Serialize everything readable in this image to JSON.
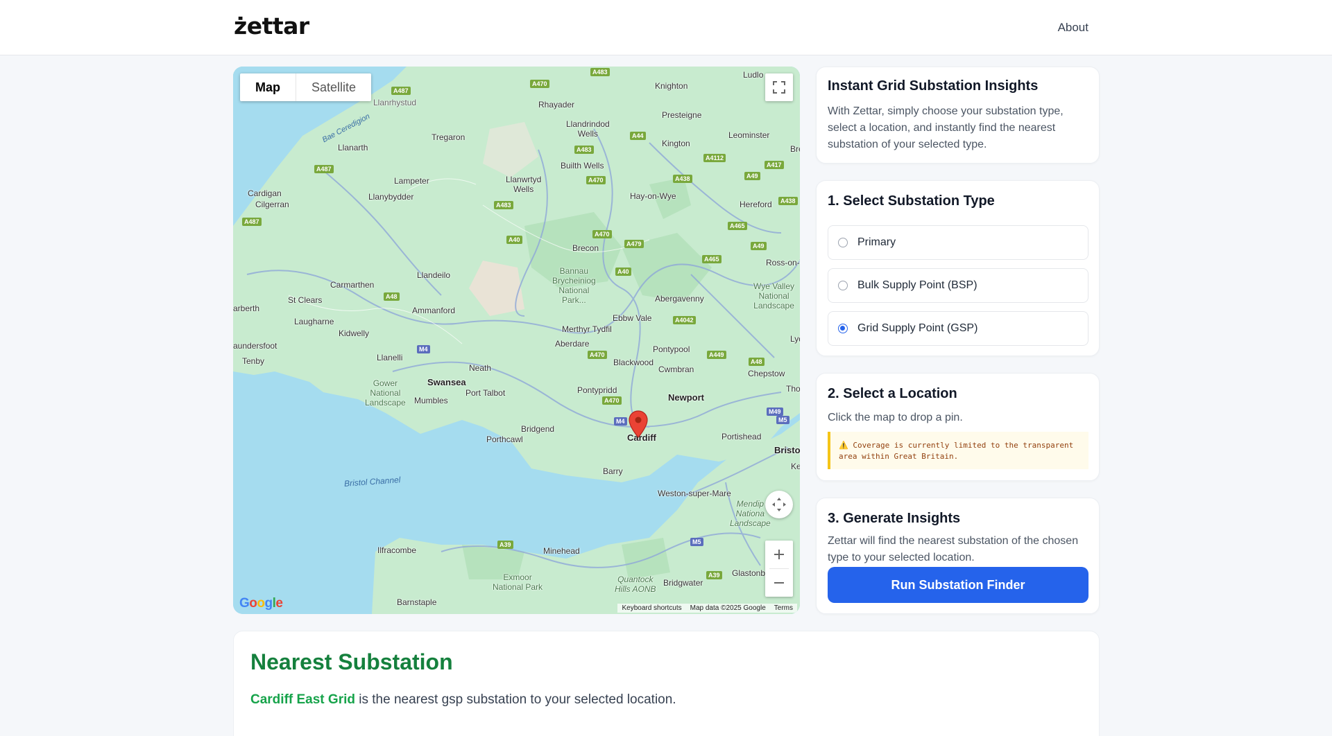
{
  "header": {
    "logo": "żettar",
    "about_link": "About"
  },
  "map": {
    "type_control": {
      "map_label": "Map",
      "satellite_label": "Satellite",
      "selected": "Map"
    },
    "attribution": {
      "shortcuts": "Keyboard shortcuts",
      "data": "Map data ©2025 Google",
      "terms": "Terms"
    },
    "google_logo": "Google",
    "pin_location": "Cardiff",
    "place_labels": {
      "ludlow": "Ludlo",
      "knighton": "Knighton",
      "rhayader": "Rhayader",
      "llanrhystud": "Llanrhystud",
      "presteigne": "Presteigne",
      "llandrindod": "Llandrindod\nWells",
      "tregaron": "Tregaron",
      "leominster": "Leominster",
      "llanarth": "Llanarth",
      "kington": "Kington",
      "builth": "Builth Wells",
      "lampeter": "Lampeter",
      "llanwrtyd": "Llanwrtyd\nWells",
      "hay": "Hay-on-Wye",
      "cardigan": "Cardigan",
      "cilgerran": "Cilgerran",
      "llanybydder": "Llanybydder",
      "hereford": "Hereford",
      "brecon": "Brecon",
      "rosson": "Ross-on-W",
      "llandeilo": "Llandeilo",
      "bannau": "Bannau\nBrycheiniog\nNational\nPark...",
      "carmarthen": "Carmarthen",
      "abergavenny": "Abergavenny",
      "wyevalley": "Wye Valley\nNational\nLandscape",
      "stclears": "St Clears",
      "narberth": "arberth",
      "ammanford": "Ammanford",
      "ebbw": "Ebbw Vale",
      "laugharne": "Laugharne",
      "merthyr": "Merthyr Tydfil",
      "kidwelly": "Kidwelly",
      "aberdare": "Aberdare",
      "pontypool": "Pontypool",
      "saundersfoot": "aundersfoot",
      "tenby": "Tenby",
      "llanelli": "Llanelli",
      "blackwood": "Blackwood",
      "neath": "Neath",
      "cwmbran": "Cwmbran",
      "chepstow": "Chepstow",
      "gower": "Gower\nNational\nLandscape",
      "swansea": "Swansea",
      "mumbles": "Mumbles",
      "porttalbot": "Port Talbot",
      "pontypridd": "Pontypridd",
      "newport": "Newport",
      "bridgend": "Bridgend",
      "porthcawl": "Porthcawl",
      "cardiff": "Cardiff",
      "portishead": "Portishead",
      "bristol": "Bristo",
      "barry": "Barry",
      "bristolchannel": "Bristol Channel",
      "weston": "Weston-super-Mare",
      "mendip": "Mendip\nNationa\nLandscape",
      "ilfracombe": "Ilfracombe",
      "minehead": "Minehead",
      "glastonbury": "Glastonb",
      "exmoor": "Exmoor\nNational Park",
      "quantock": "Quantock\nHills AONB",
      "bridgwater": "Bridgwater",
      "barnstaple": "Barnstaple",
      "baeceredigion": "Bae Ceredigion",
      "tho": "Tho",
      "ke": "Ke",
      "lyd": "Lyd",
      "bre": "Bre"
    },
    "road_labels": {
      "a487a": "A487",
      "a470a": "A470",
      "a483a": "A483",
      "a44": "A44",
      "a483b": "A483",
      "a4112": "A4112",
      "a417": "A417",
      "a49a": "A49",
      "a438a": "A438",
      "a470b": "A470",
      "a487b": "A487",
      "a483c": "A483",
      "a438b": "A438",
      "a487c": "A487",
      "a470c": "A470",
      "a465a": "A465",
      "a40a": "A40",
      "a479": "A479",
      "a49b": "A49",
      "a465b": "A465",
      "a40b": "A40",
      "a48a": "A48",
      "a4042": "A4042",
      "m4a": "M4",
      "a470d": "A470",
      "a449": "A449",
      "a48b": "A48",
      "a470e": "A470",
      "m4b": "M4",
      "m49": "M49",
      "m5a": "M5",
      "m5b": "M5",
      "a39a": "A39",
      "a39b": "A39"
    }
  },
  "panel": {
    "intro": {
      "title": "Instant Grid Substation Insights",
      "text": "With Zettar, simply choose your substation type, select a location, and instantly find the nearest substation of your selected type."
    },
    "step1": {
      "title": "1. Select Substation Type",
      "options": [
        "Primary",
        "Bulk Supply Point (BSP)",
        "Grid Supply Point (GSP)"
      ],
      "selected": "Grid Supply Point (GSP)"
    },
    "step2": {
      "title": "2. Select a Location",
      "text": "Click the map to drop a pin.",
      "warning": "⚠️ Coverage is currently limited to the transparent area within Great Britain."
    },
    "step3": {
      "title": "3. Generate Insights",
      "text": "Zettar will find the nearest substation of the chosen type to your selected location.",
      "button": "Run Substation Finder"
    }
  },
  "result": {
    "title": "Nearest Substation",
    "substation_name": "Cardiff East Grid",
    "sentence": " is the nearest gsp substation to your selected location."
  },
  "colors": {
    "accent_blue": "#2563eb",
    "result_green": "#15803d",
    "land": "#c8ebcf",
    "sea": "#a5dcef",
    "warning_bg": "#fffbeb"
  }
}
